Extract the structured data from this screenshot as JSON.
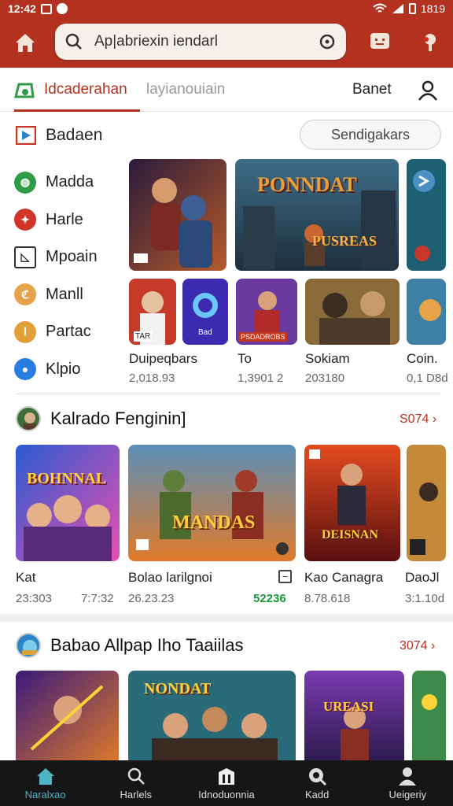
{
  "statusbar": {
    "time": "12:42",
    "right_text": "1819"
  },
  "search": {
    "text": "Ap|abriexin iendarl"
  },
  "tabs": {
    "active": "Idcaderahan",
    "second": "layianouiain",
    "right": "Banet"
  },
  "categories": {
    "title": "Badaen",
    "pill": "Sendigakars",
    "items": [
      {
        "label": "Madda",
        "color": "#2e9d46",
        "icon": "leaf-icon"
      },
      {
        "label": "Harle",
        "color": "#d3342a",
        "icon": "flame-icon"
      },
      {
        "label": "Mpoain",
        "color": "#ffffff",
        "icon": "image-icon"
      },
      {
        "label": "Manll",
        "color": "#e7a34a",
        "icon": "coin-icon"
      },
      {
        "label": "Partac",
        "color": "#e2a039",
        "icon": "token-icon"
      },
      {
        "label": "Klpio",
        "color": "#2a7de0",
        "icon": "drop-icon"
      }
    ]
  },
  "featured": {
    "banner_text_1": "PONNDAT",
    "banner_text_2": "PUSREAS",
    "small_tiles": [
      {
        "label": "Duipeqbars",
        "sub": "2,018.93",
        "tag": "TAR"
      },
      {
        "label": "To",
        "sub": "1,3901 2",
        "tag": "Bad"
      },
      {
        "label": "Sokiam",
        "sub": "203180",
        "tag": "PSDADROBS"
      },
      {
        "label": "Coin.",
        "sub": "0,1 D8d"
      }
    ]
  },
  "section2": {
    "title": "Kalrado Fenginin]",
    "more": "S074 ›",
    "cards": [
      {
        "name": "Kat",
        "meta_left": "23:303",
        "meta_right": "7:7:32",
        "art": "BOHNNAL"
      },
      {
        "name": "Bolao larilgnoi",
        "meta_left": "26.23.23",
        "meta_right": "52236",
        "art": "MANDAS"
      },
      {
        "name": "Kao Canagra",
        "meta_left": "8.78.618",
        "art": "DEISNAN"
      },
      {
        "name": "DaoJl",
        "meta_left": "3:1.10d"
      }
    ]
  },
  "section3": {
    "title": "Babao Allpap Iho Taaiilas",
    "more": "3074 ›",
    "art": [
      "NONDAT",
      "UREASI"
    ]
  },
  "bottomnav": [
    {
      "label": "Naralxao",
      "icon": "home-icon"
    },
    {
      "label": "Harlels",
      "icon": "search-icon"
    },
    {
      "label": "Idnoduonnia",
      "icon": "library-icon"
    },
    {
      "label": "Kadd",
      "icon": "discover-icon"
    },
    {
      "label": "Ueigeriy",
      "icon": "user-icon"
    }
  ],
  "colors": {
    "accent": "#b3321f",
    "nav_active": "#4fb3c8",
    "nav_bg": "#161616"
  }
}
